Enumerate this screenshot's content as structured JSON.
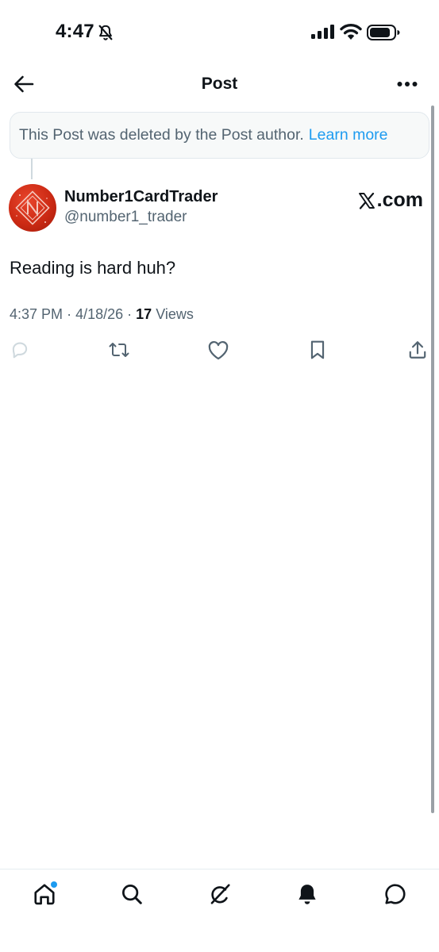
{
  "status_bar": {
    "time": "4:47",
    "icons": [
      "bell-slash-icon",
      "cellular-signal-icon",
      "wifi-icon",
      "battery-icon"
    ]
  },
  "header": {
    "title": "Post",
    "back_icon": "arrow-left-icon",
    "more_icon": "more-horizontal-icon"
  },
  "notice": {
    "text": "This Post was deleted by the Post author.",
    "link": "Learn more"
  },
  "author": {
    "name": "Number1CardTrader",
    "handle": "@number1_trader",
    "badge_text": ".com"
  },
  "post": {
    "text": "Reading is hard huh?",
    "time": "4:37 PM",
    "date": "4/18/26",
    "separator": "·",
    "views_count": "17",
    "views_label": "Views"
  },
  "actions": [
    "reply-icon",
    "repost-icon",
    "like-icon",
    "bookmark-icon",
    "share-icon"
  ],
  "tab_bar": [
    "home-icon",
    "search-icon",
    "grok-icon",
    "notifications-icon",
    "messages-icon"
  ],
  "colors": {
    "accent": "#1d9bf0",
    "text_primary": "#0f1419",
    "text_secondary": "#536471",
    "avatar_red": "#cc2a14"
  }
}
